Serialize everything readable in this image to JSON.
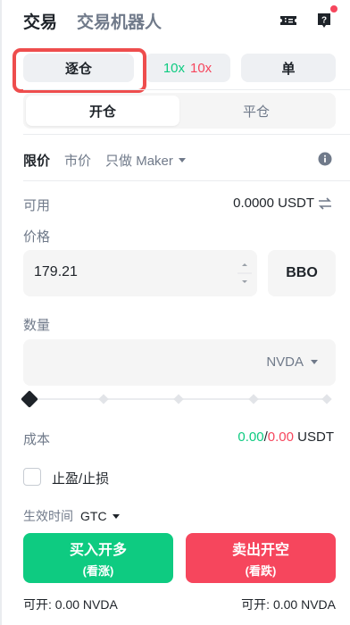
{
  "header": {
    "tabs": [
      "交易",
      "交易机器人"
    ]
  },
  "margin_row": {
    "isolated": "逐仓",
    "leverage_long": "10x",
    "leverage_short": "10x",
    "position_mode": "单"
  },
  "open_close": {
    "open": "开仓",
    "close": "平仓"
  },
  "order_types": {
    "limit": "限价",
    "market": "市价",
    "maker": "只做 Maker"
  },
  "available": {
    "label": "可用",
    "value": "0.0000 USDT"
  },
  "price": {
    "label": "价格",
    "value": "179.21",
    "bbo": "BBO"
  },
  "quantity": {
    "label": "数量",
    "unit": "NVDA",
    "slider_percent": 0
  },
  "cost": {
    "label": "成本",
    "buy": "0.00",
    "sep": "/",
    "sell": "0.00",
    "unit": "USDT"
  },
  "tpsl": {
    "label": "止盈/止损",
    "checked": false
  },
  "tif": {
    "label": "生效时间",
    "value": "GTC"
  },
  "buy_button": {
    "line1": "买入开多",
    "line2": "(看涨)"
  },
  "sell_button": {
    "line1": "卖出开空",
    "line2": "(看跌)"
  },
  "can_open": {
    "left": "可开: 0.00 NVDA",
    "right": "可开: 0.00 NVDA"
  },
  "colors": {
    "long": "#0ecb81",
    "short": "#f6465d",
    "highlight": "#ee4d4d"
  },
  "icons": [
    "ticket-icon",
    "help-icon",
    "info-icon",
    "swap-icon",
    "caret-down-icon"
  ]
}
